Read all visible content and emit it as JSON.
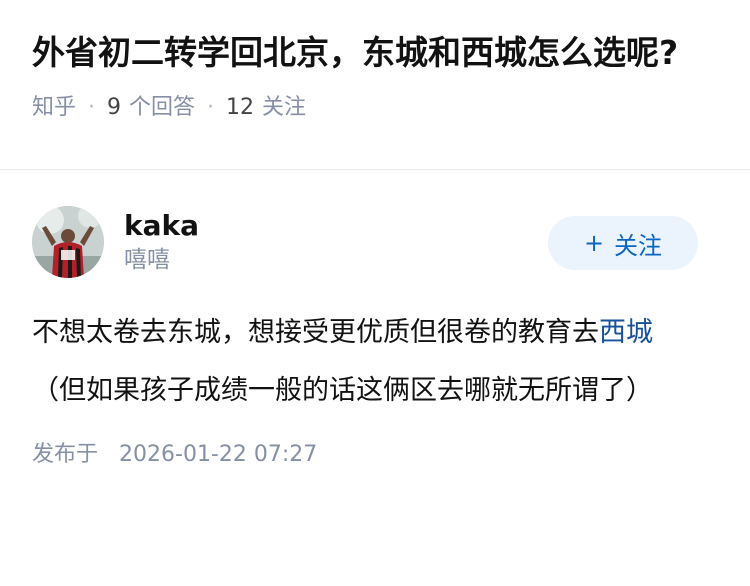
{
  "question": {
    "title": "外省初二转学回北京，东城和西城怎么选呢?",
    "source": "知乎",
    "separator": "·",
    "answer_count": "9",
    "answer_label": "个回答",
    "follow_count": "12",
    "follow_label": "关注"
  },
  "answer": {
    "author_name": "kaka",
    "author_bio": "嘻嘻",
    "follow_button": {
      "plus": "+",
      "label": "关注"
    },
    "content": {
      "before_link": "不想太卷去东城，想接受更优质但很卷的教育去",
      "link_text": "西城",
      "after_link": "（但如果孩子成绩一般的话这俩区去哪就无所谓了）"
    },
    "published_label": "发布于",
    "published_time": "2026-01-22 07:27"
  },
  "colors": {
    "accent": "#0a66c2",
    "follow_bg": "#ebf3fd",
    "meta_gray": "#8590a6",
    "link": "#175199"
  }
}
